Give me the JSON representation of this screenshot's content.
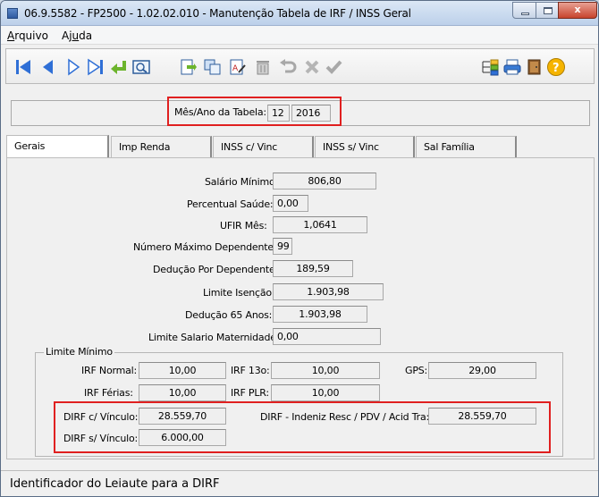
{
  "window": {
    "title": "06.9.5582 - FP2500 - 1.02.02.010 - Manutenção Tabela de IRF / INSS Geral",
    "minimize_glyph": "",
    "close_glyph": "x"
  },
  "menu": {
    "arquivo_first": "A",
    "arquivo_rest": "rquivo",
    "ajuda_first": "Aj",
    "ajuda_u": "u",
    "ajuda_rest": "da"
  },
  "toolbar": {
    "icons": [
      "first-record-icon",
      "previous-record-icon",
      "next-record-icon",
      "last-record-icon",
      "return-icon",
      "search-icon",
      "new-record-icon",
      "copy-icon",
      "edit-icon",
      "delete-icon",
      "undo-icon",
      "cancel-icon",
      "confirm-icon",
      "tree-icon",
      "print-icon",
      "exit-icon",
      "help-icon"
    ]
  },
  "header": {
    "mes_ano_label": "Mês/Ano da Tabela:",
    "mes_value": "12",
    "ano_value": "2016"
  },
  "tabs": [
    "Gerais",
    "Imp Renda",
    "INSS c/ Vinc",
    "INSS s/ Vinc",
    "Sal Família"
  ],
  "fields": {
    "salario_minimo_label": "Salário Mínimo:",
    "salario_minimo_value": "806,80",
    "percentual_saude_label": "Percentual Saúde:",
    "percentual_saude_value": "0,00",
    "ufir_label": "UFIR Mês:",
    "ufir_value": "1,0641",
    "num_dependentes_label": "Número Máximo Dependentes:",
    "num_dependentes_value": "99",
    "deducao_dependente_label": "Dedução Por Dependente:",
    "deducao_dependente_value": "189,59",
    "limite_isencao_label": "Limite Isenção:",
    "limite_isencao_value": "1.903,98",
    "deducao_65_label": "Dedução 65 Anos:",
    "deducao_65_value": "1.903,98",
    "limite_maternidade_label": "Limite Salario Maternidade:",
    "limite_maternidade_value": "0,00"
  },
  "limite_minimo": {
    "title": "Limite Mínimo",
    "irf_normal_label": "IRF Normal:",
    "irf_normal_value": "10,00",
    "irf_13_label": "IRF 13o:",
    "irf_13_value": "10,00",
    "gps_label": "GPS:",
    "gps_value": "29,00",
    "irf_ferias_label": "IRF Férias:",
    "irf_ferias_value": "10,00",
    "irf_plr_label": "IRF PLR:",
    "irf_plr_value": "10,00",
    "dirf_c_label": "DIRF c/ Vínculo:",
    "dirf_c_value": "28.559,70",
    "dirf_indeniz_label": "DIRF - Indeniz Resc / PDV / Acid Tra:",
    "dirf_indeniz_value": "28.559,70",
    "dirf_s_label": "DIRF s/ Vínculo:",
    "dirf_s_value": "6.000,00"
  },
  "status": {
    "text": "Identificador do Leiaute para a DIRF"
  }
}
